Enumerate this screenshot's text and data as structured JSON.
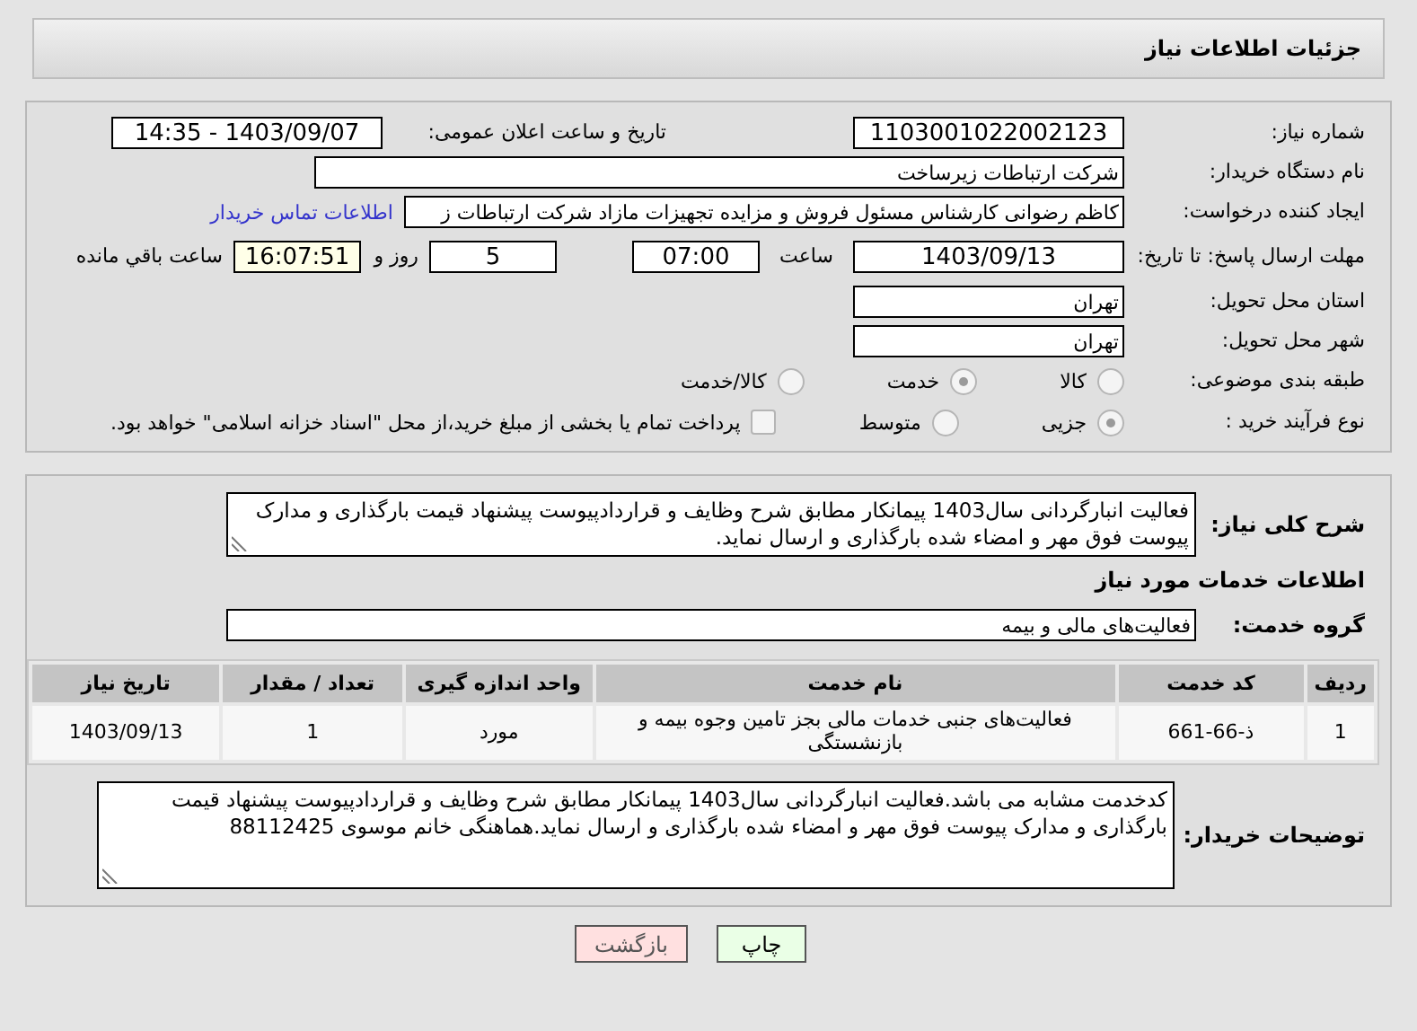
{
  "header": {
    "title": "جزئیات اطلاعات نیاز"
  },
  "need_number": {
    "label": "شماره نیاز:",
    "value": "1103001022002123"
  },
  "announce": {
    "label": "تاریخ و ساعت اعلان عمومی:",
    "value": "1403/09/07 - 14:35"
  },
  "buyer_org": {
    "label": "نام دستگاه خریدار:",
    "value": "شرکت ارتباطات زیرساخت"
  },
  "creator": {
    "label": "ایجاد کننده درخواست:",
    "value": "کاظم رضوانی کارشناس مسئول فروش و مزایده تجهیزات مازاد شرکت ارتباطات ز",
    "link": "اطلاعات تماس خریدار"
  },
  "deadline": {
    "label": "مهلت ارسال پاسخ: تا تاریخ:",
    "date": "1403/09/13",
    "time_label": "ساعت",
    "time": "07:00",
    "days": "5",
    "days_label": "روز و",
    "remaining": "16:07:51",
    "remaining_label": "ساعت باقي مانده"
  },
  "province": {
    "label": "استان محل تحویل:",
    "value": "تهران"
  },
  "city": {
    "label": "شهر محل تحویل:",
    "value": "تهران"
  },
  "category": {
    "label": "طبقه بندی موضوعی:",
    "options": [
      {
        "label": "کالا",
        "selected": false
      },
      {
        "label": "خدمت",
        "selected": true
      },
      {
        "label": "کالا/خدمت",
        "selected": false
      }
    ]
  },
  "process": {
    "label": "نوع فرآیند خرید :",
    "options": [
      {
        "label": "جزیی",
        "selected": true
      },
      {
        "label": "متوسط",
        "selected": false
      }
    ],
    "treasury": {
      "checked": false,
      "label": "پرداخت تمام یا بخشی از مبلغ خرید،از محل \"اسناد خزانه اسلامی\" خواهد بود."
    }
  },
  "description": {
    "label": "شرح کلی نیاز:",
    "value": "فعالیت انبارگردانی سال1403 پیمانکار مطابق شرح وظایف و قراردادپیوست پیشنهاد قیمت بارگذاری و مدارک پیوست فوق مهر و امضاء شده بارگذاری و ارسال نماید."
  },
  "services_title": "اطلاعات خدمات مورد نیاز",
  "service_group": {
    "label": "گروه خدمت:",
    "value": "فعالیت‌های مالی و بیمه"
  },
  "table": {
    "columns": [
      "ردیف",
      "کد خدمت",
      "نام خدمت",
      "واحد اندازه گیری",
      "تعداد / مقدار",
      "تاریخ نیاز"
    ],
    "rows": [
      [
        "1",
        "ذ-66-661",
        "فعالیت‌های جنبی خدمات مالی بجز تامین وجوه بیمه و بازنشستگی",
        "مورد",
        "1",
        "1403/09/13"
      ]
    ]
  },
  "notes": {
    "label": "توضیحات خریدار:",
    "value": "کدخدمت مشابه می باشد.فعالیت انبارگردانی سال1403 پیمانکار مطابق شرح وظایف و قراردادپیوست پیشنهاد قیمت بارگذاری و مدارک پیوست فوق مهر و امضاء شده بارگذاری و ارسال نماید.هماهنگی خانم موسوی 88112425"
  },
  "buttons": [
    {
      "label": "چاپ",
      "kind": "print"
    },
    {
      "label": "بازگشت",
      "kind": "back"
    }
  ]
}
